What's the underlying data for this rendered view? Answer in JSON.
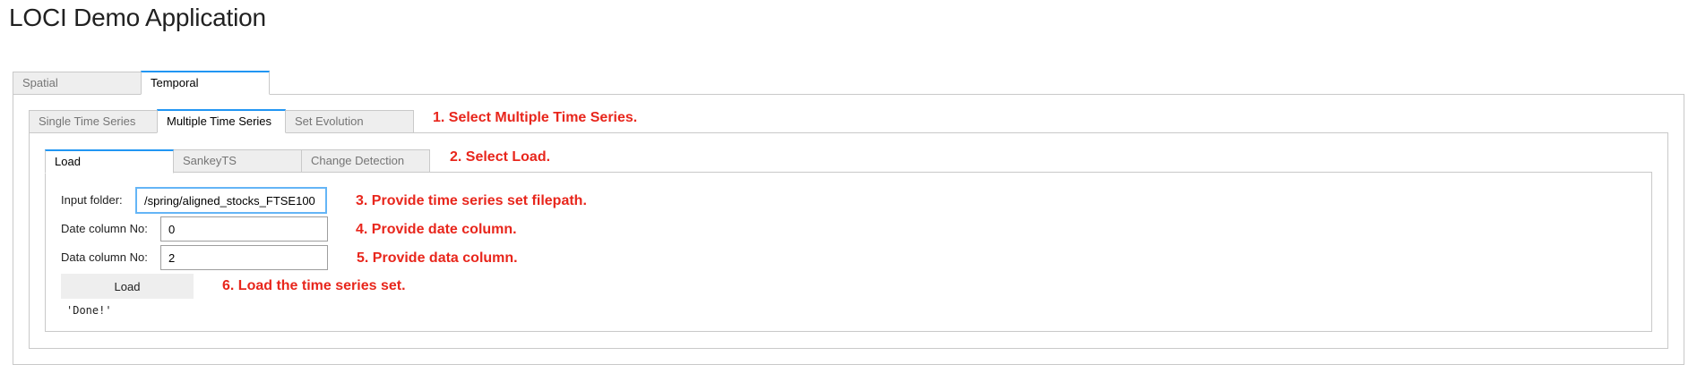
{
  "app": {
    "title": "LOCI Demo Application"
  },
  "outer_tabs": [
    {
      "label": "Spatial",
      "active": false
    },
    {
      "label": "Temporal",
      "active": true
    }
  ],
  "temporal_tabs": [
    {
      "label": "Single Time Series",
      "active": false
    },
    {
      "label": "Multiple Time Series",
      "active": true
    },
    {
      "label": "Set Evolution",
      "active": false
    }
  ],
  "multiple_tabs": [
    {
      "label": "Load",
      "active": true
    },
    {
      "label": "SankeyTS",
      "active": false
    },
    {
      "label": "Change Detection",
      "active": false
    }
  ],
  "form": {
    "input_folder": {
      "label": "Input folder:",
      "value": "spring/aligned_stocks_FTSE100/",
      "visible_text": "spring/aligned_stocks_FTSE100/"
    },
    "date_column": {
      "label": "Date column No:",
      "value": "0"
    },
    "data_column": {
      "label": "Data column No:",
      "value": "2"
    },
    "load_button_label": "Load",
    "output": "'Done!'"
  },
  "annotations": [
    "1. Select Multiple Time Series.",
    "2. Select Load.",
    "3. Provide time series set filepath.",
    "4. Provide date column.",
    "5. Provide data column.",
    "6. Load the time series set."
  ],
  "colors": {
    "annotation": "#e8261c",
    "active_tab_accent": "#2196f3",
    "focus_ring": "#64b5f6",
    "tab_inactive_bg": "#eeeeee",
    "border": "#c9c9c9"
  }
}
